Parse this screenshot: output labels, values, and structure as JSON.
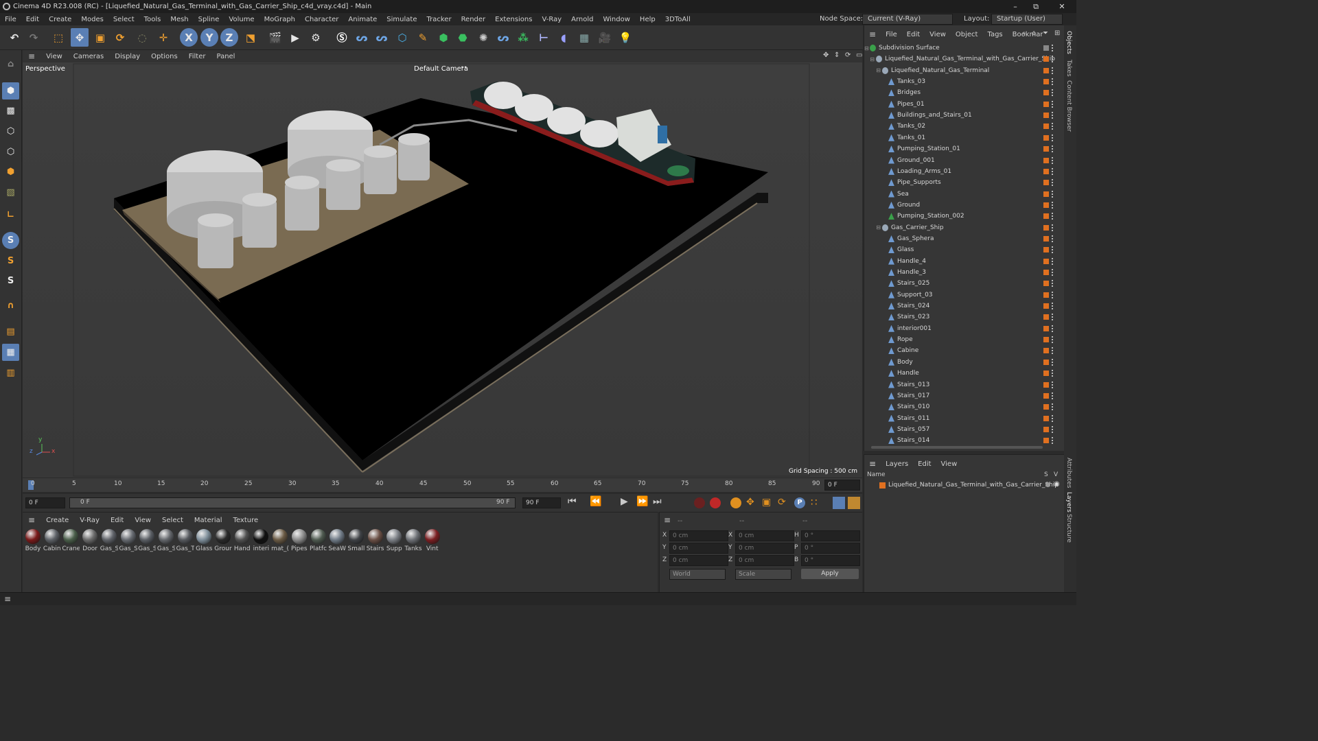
{
  "window": {
    "title": "Cinema 4D R23.008 (RC) - [Liquefied_Natural_Gas_Terminal_with_Gas_Carrier_Ship_c4d_vray.c4d] - Main",
    "minimize": "–",
    "restore": "⧉",
    "close": "✕"
  },
  "menubar": {
    "items": [
      "File",
      "Edit",
      "Create",
      "Modes",
      "Select",
      "Tools",
      "Mesh",
      "Spline",
      "Volume",
      "MoGraph",
      "Character",
      "Animate",
      "Simulate",
      "Tracker",
      "Render",
      "Extensions",
      "V-Ray",
      "Arnold",
      "Window",
      "Help",
      "3DToAll"
    ],
    "node_space_label": "Node Space:",
    "node_space_value": "Current (V-Ray)",
    "layout_label": "Layout:",
    "layout_value": "Startup (User)"
  },
  "toolbar": {
    "axis_x": "X",
    "axis_y": "Y",
    "axis_z": "Z"
  },
  "viewport": {
    "menu": [
      "View",
      "Cameras",
      "Display",
      "Options",
      "Filter",
      "Panel"
    ],
    "label": "Perspective",
    "camera": "Default Camera",
    "camera_icon": "••",
    "grid_spacing": "Grid Spacing : 500 cm",
    "axis_labels": {
      "z": "z",
      "y": "y",
      "x": "x"
    }
  },
  "timeline": {
    "ticks": [
      "0",
      "5",
      "10",
      "15",
      "20",
      "25",
      "30",
      "35",
      "40",
      "45",
      "50",
      "55",
      "60",
      "65",
      "70",
      "75",
      "80",
      "85",
      "90"
    ],
    "right_field": "0 F",
    "current_frame": "0 F",
    "start_frame": "0 F",
    "end_frame_a": "90 F",
    "end_frame_b": "90 F",
    "playback": {
      "first": "⏮",
      "prev_key": "⏪",
      "play": "▶",
      "next_key": "⏩",
      "last": "⏭"
    },
    "keying": {
      "pos": "✥",
      "scale": "▣",
      "rot": "⟳",
      "param": "P",
      "pla": "∷"
    }
  },
  "materials": {
    "menu": [
      "Create",
      "V-Ray",
      "Edit",
      "View",
      "Select",
      "Material",
      "Texture"
    ],
    "items": [
      {
        "name": "Body",
        "color": "#7a1a1a"
      },
      {
        "name": "Cabin",
        "color": "#5d6166"
      },
      {
        "name": "Crane",
        "color": "#4a5e4a"
      },
      {
        "name": "Door",
        "color": "#6b6b6b"
      },
      {
        "name": "Gas_S",
        "color": "#5f6268"
      },
      {
        "name": "Gas_S",
        "color": "#666a70"
      },
      {
        "name": "Gas_S",
        "color": "#5a5e64"
      },
      {
        "name": "Gas_S",
        "color": "#63666b"
      },
      {
        "name": "Gas_T",
        "color": "#55585d"
      },
      {
        "name": "Glass",
        "color": "#7d8d99"
      },
      {
        "name": "Grour",
        "color": "#2a2a2a"
      },
      {
        "name": "Hand",
        "color": "#505050"
      },
      {
        "name": "interi",
        "color": "#111111"
      },
      {
        "name": "mat_(",
        "color": "#6a5a44"
      },
      {
        "name": "Pipes",
        "color": "#8c8c8c"
      },
      {
        "name": "Platfc",
        "color": "#4f5a50"
      },
      {
        "name": "SeaW",
        "color": "#6f7a86"
      },
      {
        "name": "Small",
        "color": "#3f4246"
      },
      {
        "name": "Stairs",
        "color": "#6a4f45"
      },
      {
        "name": "Supp",
        "color": "#7a7e84"
      },
      {
        "name": "Tanks",
        "color": "#6d7075"
      },
      {
        "name": "Vint",
        "color": "#7c1f22"
      }
    ]
  },
  "attributes": {
    "header_a": "--",
    "header_b": "--",
    "header_c": "--",
    "rows": [
      {
        "l1": "X",
        "v1": "0 cm",
        "l2": "X",
        "v2": "0 cm",
        "l3": "H",
        "v3": "0 °"
      },
      {
        "l1": "Y",
        "v1": "0 cm",
        "l2": "Y",
        "v2": "0 cm",
        "l3": "P",
        "v3": "0 °"
      },
      {
        "l1": "Z",
        "v1": "0 cm",
        "l2": "Z",
        "v2": "0 cm",
        "l3": "B",
        "v3": "0 °"
      }
    ],
    "coord_system": "World",
    "size_mode": "Scale",
    "apply": "Apply"
  },
  "objects": {
    "menu": [
      "File",
      "Edit",
      "View",
      "Object",
      "Tags",
      "Bookmar"
    ],
    "rows": [
      {
        "name": "Subdivision Surface",
        "indent": 0,
        "icon": "#3aa04a"
      },
      {
        "name": "Liquefied_Natural_Gas_Terminal_with_Gas_Carrier_Ship",
        "indent": 1,
        "icon": "#9aa8b8"
      },
      {
        "name": "Liquefied_Natural_Gas_Terminal",
        "indent": 2,
        "icon": "#9aa8b8"
      },
      {
        "name": "Tanks_03",
        "indent": 3,
        "icon": "#6f9ad0"
      },
      {
        "name": "Bridges",
        "indent": 3,
        "icon": "#6f9ad0"
      },
      {
        "name": "Pipes_01",
        "indent": 3,
        "icon": "#6f9ad0"
      },
      {
        "name": "Buildings_and_Stairs_01",
        "indent": 3,
        "icon": "#6f9ad0"
      },
      {
        "name": "Tanks_02",
        "indent": 3,
        "icon": "#6f9ad0"
      },
      {
        "name": "Tanks_01",
        "indent": 3,
        "icon": "#6f9ad0"
      },
      {
        "name": "Pumping_Station_01",
        "indent": 3,
        "icon": "#6f9ad0"
      },
      {
        "name": "Ground_001",
        "indent": 3,
        "icon": "#6f9ad0"
      },
      {
        "name": "Loading_Arms_01",
        "indent": 3,
        "icon": "#6f9ad0"
      },
      {
        "name": "Pipe_Supports",
        "indent": 3,
        "icon": "#6f9ad0"
      },
      {
        "name": "Sea",
        "indent": 3,
        "icon": "#6f9ad0"
      },
      {
        "name": "Ground",
        "indent": 3,
        "icon": "#6f9ad0"
      },
      {
        "name": "Pumping_Station_002",
        "indent": 3,
        "icon": "#3aa04a"
      },
      {
        "name": "Gas_Carrier_Ship",
        "indent": 2,
        "icon": "#9aa8b8"
      },
      {
        "name": "Gas_Sphera",
        "indent": 3,
        "icon": "#6f9ad0"
      },
      {
        "name": "Glass",
        "indent": 3,
        "icon": "#6f9ad0"
      },
      {
        "name": "Handle_4",
        "indent": 3,
        "icon": "#6f9ad0"
      },
      {
        "name": "Handle_3",
        "indent": 3,
        "icon": "#6f9ad0"
      },
      {
        "name": "Stairs_025",
        "indent": 3,
        "icon": "#6f9ad0"
      },
      {
        "name": "Support_03",
        "indent": 3,
        "icon": "#6f9ad0"
      },
      {
        "name": "Stairs_024",
        "indent": 3,
        "icon": "#6f9ad0"
      },
      {
        "name": "Stairs_023",
        "indent": 3,
        "icon": "#6f9ad0"
      },
      {
        "name": "interior001",
        "indent": 3,
        "icon": "#6f9ad0"
      },
      {
        "name": "Rope",
        "indent": 3,
        "icon": "#6f9ad0"
      },
      {
        "name": "Cabine",
        "indent": 3,
        "icon": "#6f9ad0"
      },
      {
        "name": "Body",
        "indent": 3,
        "icon": "#6f9ad0"
      },
      {
        "name": "Handle",
        "indent": 3,
        "icon": "#6f9ad0"
      },
      {
        "name": "Stairs_013",
        "indent": 3,
        "icon": "#6f9ad0"
      },
      {
        "name": "Stairs_017",
        "indent": 3,
        "icon": "#6f9ad0"
      },
      {
        "name": "Stairs_010",
        "indent": 3,
        "icon": "#6f9ad0"
      },
      {
        "name": "Stairs_011",
        "indent": 3,
        "icon": "#6f9ad0"
      },
      {
        "name": "Stairs_057",
        "indent": 3,
        "icon": "#6f9ad0"
      },
      {
        "name": "Stairs_014",
        "indent": 3,
        "icon": "#6f9ad0"
      }
    ]
  },
  "layers": {
    "menu": [
      "Layers",
      "Edit",
      "View"
    ],
    "col_name": "Name",
    "col_s": "S",
    "col_v": "V",
    "row": "Liquefied_Natural_Gas_Terminal_with_Gas_Carrier_Ship"
  },
  "right_tabs": [
    "Objects",
    "Takes",
    "Content Browser",
    "Attributes",
    "Layers",
    "Structure"
  ],
  "colors": {
    "accent": "#5a7fb4",
    "tag": "#e07020",
    "bg": "#2b2b2b"
  }
}
